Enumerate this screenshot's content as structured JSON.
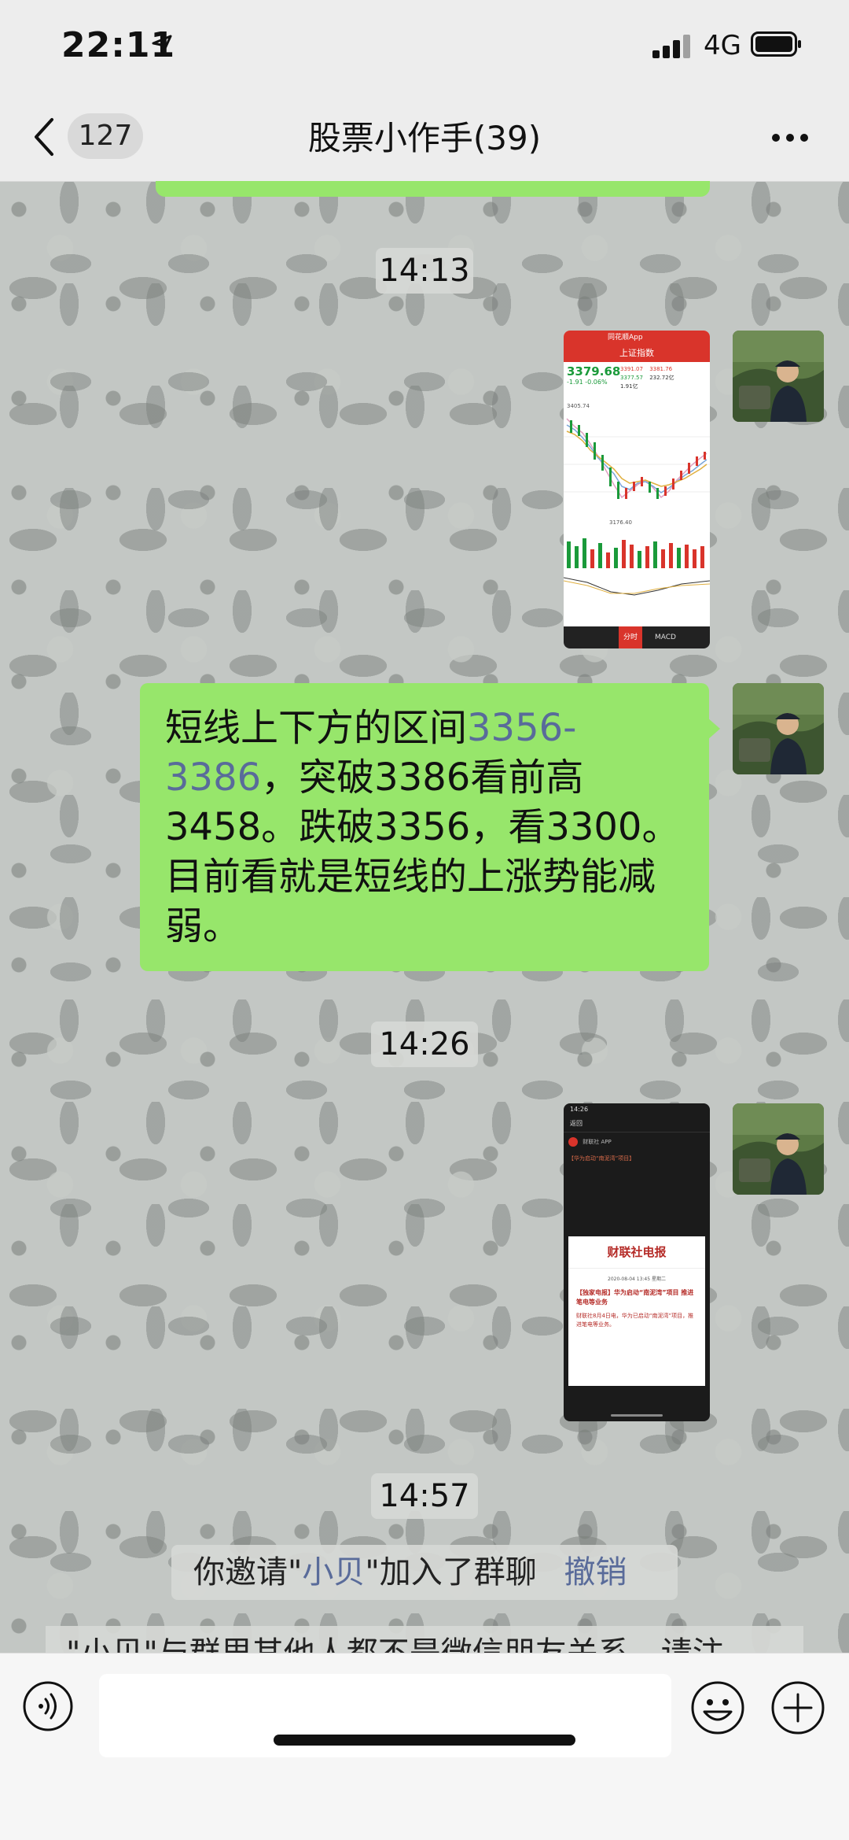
{
  "status_bar": {
    "time": "22:11",
    "network": "4G"
  },
  "nav": {
    "unread_count": "127",
    "title": "股票小作手(39)"
  },
  "messages": {
    "t1": "14:13",
    "text_message": {
      "part1": "短线上下方的区间",
      "link": "3356-3386",
      "part2": "，突破3386看前高3458。跌破3356，看3300。目前看就是短线的上涨势能减弱。"
    },
    "t2": "14:26",
    "t3": "14:57",
    "system": {
      "prefix": "你邀请\"",
      "name": "小贝",
      "suffix": "\"加入了群聊",
      "revoke": "撤销"
    },
    "system2": "\"小贝\"与群里其他人都不是微信朋友关系，请注"
  },
  "stock_screenshot": {
    "app_name": "同花顺App",
    "index_name": "上证指数",
    "price": "3379.68",
    "change": "-1.91 -0.06%",
    "open": "3391.07",
    "high": "3381.76",
    "volume": "1.91亿",
    "low": "3377.57",
    "amount": "232.72亿",
    "top_value": "3405.74",
    "low_value": "3176.40",
    "indicator": "MACD",
    "bottom_tab": "分时"
  },
  "news_screenshot": {
    "time": "14:26",
    "back": "返回",
    "app_name": "财联社 APP",
    "headline": "【华为启动“南泥湾”项目】",
    "banner": "财联社电报",
    "date": "2020-08-04 13:45 星期二",
    "subhead": "【独家电报】华为启动“南泥湾”项目 推进笔电等业务",
    "body_preview": "财联社8月4日电，华为已启动“南泥湾”项目，推进笔电等业务。"
  },
  "colors": {
    "bubble": "#97e66b",
    "link": "#596b9a",
    "stock_red": "#d9342b"
  }
}
